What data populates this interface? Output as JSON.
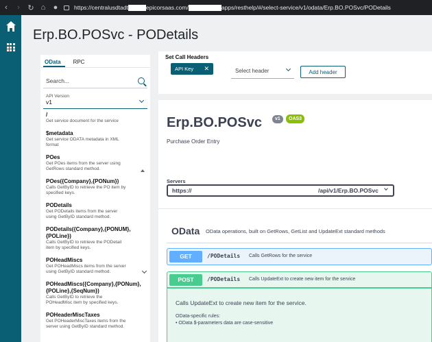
{
  "browser": {
    "url_prefix": "https://centralusdtadt",
    "url_mid": "epicorsaas.com/",
    "url_suffix": "apps/resthelp/#/select-service/v1/odata/Erp.BO.POSvc/PODetails"
  },
  "page": {
    "title": "Erp.BO.POSvc - PODetails"
  },
  "left_panel": {
    "tabs": [
      {
        "label": "OData",
        "active": true
      },
      {
        "label": "RPC",
        "active": false
      }
    ],
    "search_placeholder": "Search...",
    "api_version_label": "API Version",
    "api_version_value": "v1",
    "operations": [
      {
        "name": "/",
        "desc": "Get service document for the service"
      },
      {
        "name": "$metadata",
        "desc": "Get service ODATA metadata in XML format"
      },
      {
        "name": "POes",
        "desc": "Get POes items from the server using GetRows standard method."
      },
      {
        "name": "POes({Company},{PONum})",
        "desc": "Calls GetByID to retrieve the PO item by specified keys."
      },
      {
        "name": "PODetails",
        "desc": "Get PODetails items from the server using GetByID standard method."
      },
      {
        "name": "PODetails({Company},{PONUM},{POLine})",
        "desc": "Calls GetByID to retrieve the PODetail item by specified keys."
      },
      {
        "name": "POHeadMiscs",
        "desc": "Get POHeadMiscs items from the server using GetByID standard method."
      },
      {
        "name": "POHeadMiscs({Company},{PONum},{POLine},{SeqNum})",
        "desc": "Calls GetByID to retrieve the POHeadMisc item by specified keys."
      },
      {
        "name": "POHeaderMiscTaxes",
        "desc": "Get POHeaderMiscTaxes items from the server using GetByID standard method."
      }
    ]
  },
  "call_headers": {
    "title": "Set Call Headers",
    "chip_label": "API Key",
    "chip_close": "✕",
    "select_placeholder": "Select header",
    "add_button": "Add header"
  },
  "api": {
    "title": "Erp.BO.POSvc",
    "version_badge": "v1",
    "oas_badge": "OAS3",
    "description": "Purchase Order Entry",
    "servers_label": "Servers",
    "server_prefix": "https://",
    "server_suffix": "/api/v1/Erp.BO.POSvc"
  },
  "tag": {
    "name": "OData",
    "description": "OData operations, built on GetRows, GetList and UpdateExt standard methods"
  },
  "endpoints": [
    {
      "method": "GET",
      "path": "/PODetails",
      "summary": "Calls GetRows for the service"
    },
    {
      "method": "POST",
      "path": "/PODetails",
      "summary": "Calls UpdateExt to create new item for the service"
    }
  ],
  "post_details": {
    "description": "Calls UpdateExt to create new item for the service.",
    "rules_title": "OData-specific rules:",
    "rules": [
      "OData $-parameters data are case-sensitive"
    ]
  },
  "colors": {
    "rail": "#0a5f75",
    "get": "#61affe",
    "post": "#49cc90",
    "oas": "#89bf04"
  },
  "icons": [
    "back-icon",
    "forward-icon",
    "reload-icon",
    "home-icon",
    "microphone-icon",
    "address-bar-icon",
    "apps-grid-icon",
    "search-icon",
    "chevron-down-icon",
    "close-icon"
  ]
}
